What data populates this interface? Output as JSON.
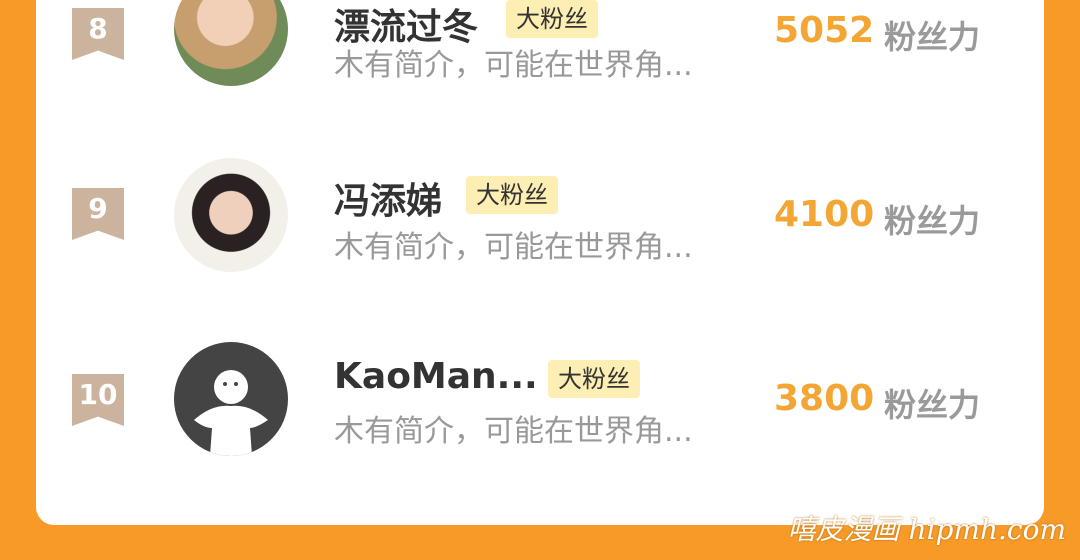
{
  "rows": [
    {
      "rank": "8",
      "name": "漂流过冬",
      "badge": "大粉丝",
      "intro": "木有简介，可能在世界角...",
      "score": "5052",
      "unit": "粉丝力"
    },
    {
      "rank": "9",
      "name": "冯添娣",
      "badge": "大粉丝",
      "intro": "木有简介，可能在世界角...",
      "score": "4100",
      "unit": "粉丝力"
    },
    {
      "rank": "10",
      "name": "KaoMan...",
      "badge": "大粉丝",
      "intro": "木有简介，可能在世界角...",
      "score": "3800",
      "unit": "粉丝力"
    }
  ],
  "watermark": "嘻皮漫画 hipmh.com",
  "colors": {
    "background": "#f79a28",
    "score": "#f3a633",
    "badge_bg": "#fdeeb4",
    "rank_bg": "#ccb39e"
  }
}
